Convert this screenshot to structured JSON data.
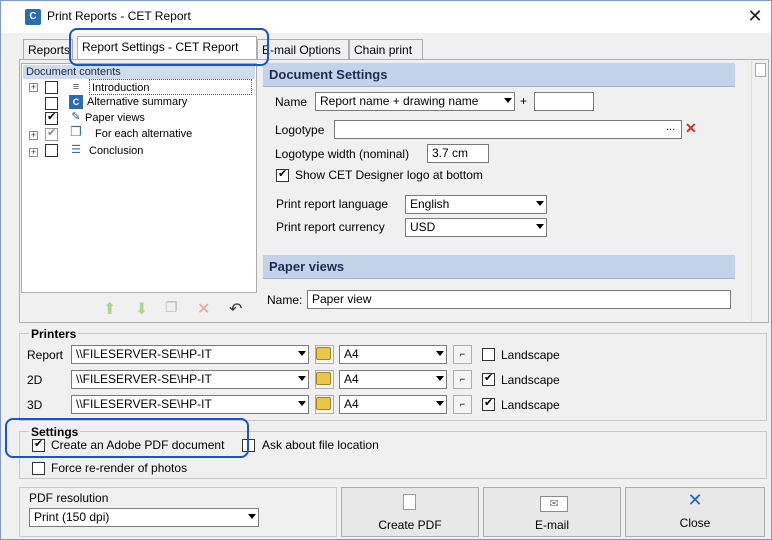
{
  "window": {
    "title": "Print Reports - CET Report",
    "app_icon": "cet-app-icon",
    "close_glyph": "✕"
  },
  "tabs": [
    {
      "label": "Reports"
    },
    {
      "label": "Report Settings - CET Report"
    },
    {
      "label": "E-mail Options"
    },
    {
      "label": "Chain print"
    }
  ],
  "tree": {
    "header": "Document contents",
    "items": [
      {
        "label": "Introduction",
        "checked": false,
        "expandable": true
      },
      {
        "label": "Alternative summary",
        "checked": false,
        "expandable": false
      },
      {
        "label": "Paper views",
        "checked": true,
        "expandable": false
      },
      {
        "label": "For each alternative",
        "checked": true,
        "expandable": true
      },
      {
        "label": "Conclusion",
        "checked": false,
        "expandable": true
      }
    ],
    "tools": [
      "move-up-icon",
      "move-down-icon",
      "copy-icon",
      "delete-icon",
      "undo-icon"
    ]
  },
  "document_settings": {
    "header": "Document Settings",
    "name_label": "Name",
    "name_value": "Report name + drawing name",
    "plus": "+",
    "suffix_value": "",
    "logotype_label": "Logotype",
    "logotype_value": "",
    "browse": "...",
    "logo_width_label": "Logotype width (nominal)",
    "logo_width_value": "3.7 cm",
    "show_logo_label": "Show CET Designer logo at bottom",
    "show_logo_checked": true,
    "language_label": "Print report language",
    "language_value": "English",
    "currency_label": "Print report currency",
    "currency_value": "USD"
  },
  "paper_views": {
    "header": "Paper views",
    "name_label": "Name:",
    "name_value": "Paper view"
  },
  "printers": {
    "title": "Printers",
    "rows": [
      {
        "label": "Report",
        "printer": "\\\\FILESERVER-SE\\HP-IT",
        "paper": "A4",
        "landscape_label": "Landscape",
        "landscape": false
      },
      {
        "label": "2D",
        "printer": "\\\\FILESERVER-SE\\HP-IT",
        "paper": "A4",
        "landscape_label": "Landscape",
        "landscape": true
      },
      {
        "label": "3D",
        "printer": "\\\\FILESERVER-SE\\HP-IT",
        "paper": "A4",
        "landscape_label": "Landscape",
        "landscape": true
      }
    ]
  },
  "settings": {
    "title": "Settings",
    "create_pdf_label": "Create an Adobe PDF document",
    "create_pdf_checked": true,
    "ask_location_label": "Ask about file location",
    "ask_location_checked": false,
    "rerender_label": "Force re-render of photos",
    "rerender_checked": false
  },
  "pdf": {
    "resolution_label": "PDF resolution",
    "resolution_value": "Print (150 dpi)"
  },
  "buttons": {
    "create_pdf": "Create PDF",
    "email": "E-mail",
    "close": "Close"
  },
  "colors": {
    "highlight": "#1a52d6",
    "section_header": "#c5d3ea",
    "close_icon": "#1f63c9"
  }
}
